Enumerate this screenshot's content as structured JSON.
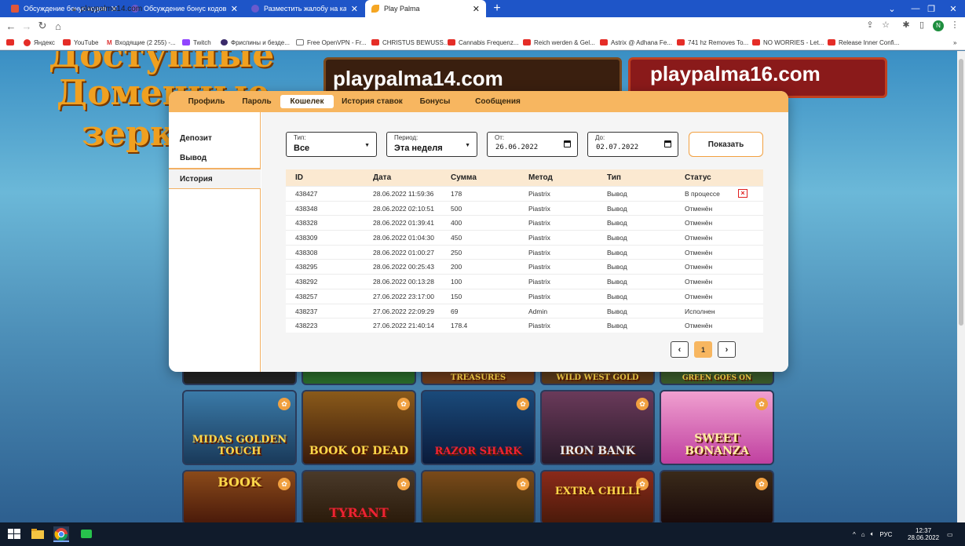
{
  "browser": {
    "tabs": [
      {
        "label": "Обсуждение бонус кодов и бо",
        "color": "#e0573a"
      },
      {
        "label": "Обсуждение бонус кодов и бо",
        "color": "#6a5acd"
      },
      {
        "label": "Разместить жалобу на казино",
        "color": "#6a5acd"
      },
      {
        "label": "Play Palma",
        "color": "#f5a623"
      }
    ],
    "url": "playpalma14.com",
    "profile_initial": "N",
    "bookmarks": [
      "Яндекс",
      "YouTube",
      "Входящие (2 255) -...",
      "Twitch",
      "Фриспины и безде...",
      "Free OpenVPN - Fr...",
      "CHRISTUS BEWUSS...",
      "Cannabis Frequenz...",
      "Reich werden & Gel...",
      "Astrix @ Adhana Fe...",
      "741 hz Removes To...",
      "NO WORRIES - Let...",
      "Release Inner Confi..."
    ]
  },
  "background": {
    "promo_left": "playpalma14.com",
    "promo_right": "playpalma16.com",
    "headline": [
      "Доступные",
      "Доменные",
      "зеркала"
    ],
    "games_top": [
      "",
      "",
      "TREASURES",
      "WILD WEST GOLD",
      "GREEN GOES ON"
    ],
    "games_mid": [
      "MIDAS GOLDEN TOUCH",
      "BOOK OF DEAD",
      "RAZOR SHARK",
      "IRON BANK",
      "SWEET BONANZA"
    ],
    "games_bot": [
      "BOOK",
      "TYRANT",
      "",
      "EXTRA CHILLI",
      ""
    ]
  },
  "modal": {
    "tabs": [
      "Профиль",
      "Пароль",
      "Кошелек",
      "История ставок",
      "Бонусы",
      "Сообщения"
    ],
    "active_tab": "Кошелек",
    "sidebar": [
      "Депозит",
      "Вывод",
      "История"
    ],
    "active_sidebar": "История",
    "filters": {
      "type": {
        "label": "Тип:",
        "value": "Все"
      },
      "period": {
        "label": "Период:",
        "value": "Эта неделя"
      },
      "from": {
        "label": "От:",
        "value": "26.06.2022"
      },
      "to": {
        "label": "До:",
        "value": "02.07.2022"
      },
      "show_button": "Показать"
    },
    "table": {
      "headers": [
        "ID",
        "Дата",
        "Сумма",
        "Метод",
        "Тип",
        "Статус"
      ],
      "rows": [
        {
          "id": "438427",
          "date": "28.06.2022 11:59:36",
          "amount": "178",
          "method": "Piastrix",
          "type": "Вывод",
          "status": "В процессе",
          "cancelable": true
        },
        {
          "id": "438348",
          "date": "28.06.2022 02:10:51",
          "amount": "500",
          "method": "Piastrix",
          "type": "Вывод",
          "status": "Отменён"
        },
        {
          "id": "438328",
          "date": "28.06.2022 01:39:41",
          "amount": "400",
          "method": "Piastrix",
          "type": "Вывод",
          "status": "Отменён"
        },
        {
          "id": "438309",
          "date": "28.06.2022 01:04:30",
          "amount": "450",
          "method": "Piastrix",
          "type": "Вывод",
          "status": "Отменён"
        },
        {
          "id": "438308",
          "date": "28.06.2022 01:00:27",
          "amount": "250",
          "method": "Piastrix",
          "type": "Вывод",
          "status": "Отменён"
        },
        {
          "id": "438295",
          "date": "28.06.2022 00:25:43",
          "amount": "200",
          "method": "Piastrix",
          "type": "Вывод",
          "status": "Отменён"
        },
        {
          "id": "438292",
          "date": "28.06.2022 00:13:28",
          "amount": "100",
          "method": "Piastrix",
          "type": "Вывод",
          "status": "Отменён"
        },
        {
          "id": "438257",
          "date": "27.06.2022 23:17:00",
          "amount": "150",
          "method": "Piastrix",
          "type": "Вывод",
          "status": "Отменён"
        },
        {
          "id": "438237",
          "date": "27.06.2022 22:09:29",
          "amount": "69",
          "method": "Admin",
          "type": "Вывод",
          "status": "Исполнен"
        },
        {
          "id": "438223",
          "date": "27.06.2022 21:40:14",
          "amount": "178.4",
          "method": "Piastrix",
          "type": "Вывод",
          "status": "Отменён"
        }
      ]
    },
    "pagination": {
      "prev": "‹",
      "current": "1",
      "next": "›"
    }
  },
  "taskbar": {
    "lang": "РУС",
    "time": "12:37",
    "date": "28.06.2022"
  },
  "colors": {
    "accent": "#f7b660",
    "chrome_blue": "#1e55c8",
    "cancel_red": "#e02020"
  }
}
